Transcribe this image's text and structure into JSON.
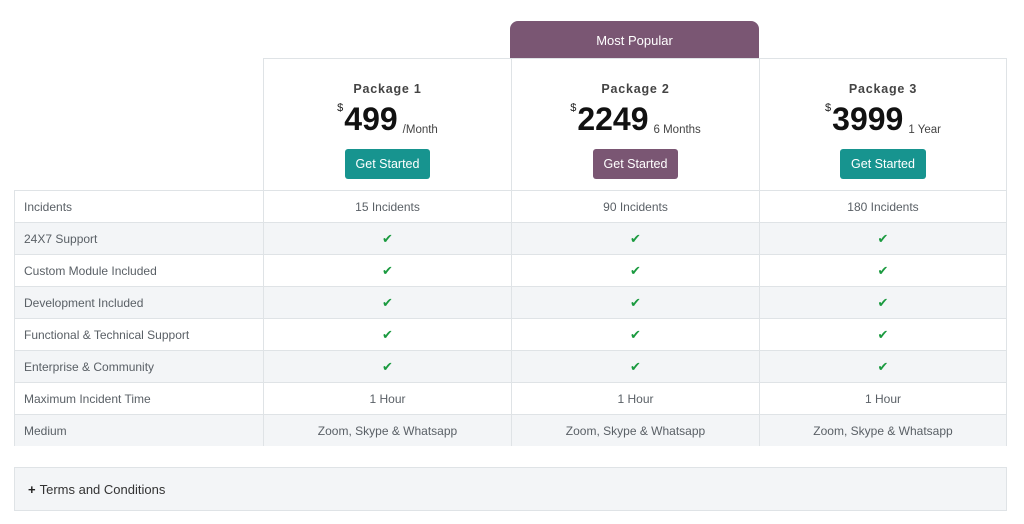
{
  "popular_label": "Most Popular",
  "packages": [
    {
      "name": "Package 1",
      "currency": "$",
      "amount": "499",
      "period": "/Month",
      "button": "Get Started",
      "accent": "#17948f"
    },
    {
      "name": "Package 2",
      "currency": "$",
      "amount": "2249",
      "period": "6 Months",
      "button": "Get Started",
      "accent": "#7a5673"
    },
    {
      "name": "Package 3",
      "currency": "$",
      "amount": "3999",
      "period": "1 Year",
      "button": "Get Started",
      "accent": "#17948f"
    }
  ],
  "features": [
    {
      "label": "Incidents",
      "values": [
        "15 Incidents",
        "90 Incidents",
        "180 Incidents"
      ]
    },
    {
      "label": "24X7 Support",
      "values": [
        "check",
        "check",
        "check"
      ]
    },
    {
      "label": "Custom Module Included",
      "values": [
        "check",
        "check",
        "check"
      ]
    },
    {
      "label": "Development Included",
      "values": [
        "check",
        "check",
        "check"
      ]
    },
    {
      "label": "Functional & Technical Support",
      "values": [
        "check",
        "check",
        "check"
      ]
    },
    {
      "label": "Enterprise & Community",
      "values": [
        "check",
        "check",
        "check"
      ]
    },
    {
      "label": "Maximum Incident Time",
      "values": [
        "1 Hour",
        "1 Hour",
        "1 Hour"
      ]
    },
    {
      "label": "Medium",
      "values": [
        "Zoom, Skype & Whatsapp",
        "Zoom, Skype & Whatsapp",
        "Zoom, Skype & Whatsapp"
      ]
    }
  ],
  "check_icon": "check-icon",
  "terms": {
    "plus": "+",
    "label": "Terms and Conditions"
  }
}
